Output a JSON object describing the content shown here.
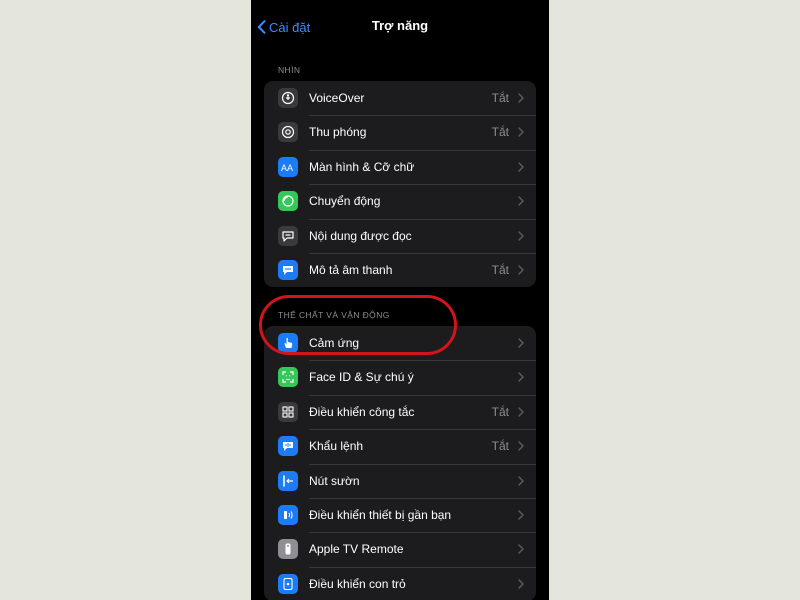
{
  "nav": {
    "back_label": "Cài đặt",
    "title": "Trợ năng"
  },
  "sections": [
    {
      "header": "NHÌN",
      "rows": [
        {
          "label": "VoiceOver",
          "value": "Tắt",
          "icon": "voiceover-icon",
          "color": "#3a3a3c"
        },
        {
          "label": "Thu phóng",
          "value": "Tắt",
          "icon": "zoom-icon",
          "color": "#3a3a3c"
        },
        {
          "label": "Màn hình & Cỡ chữ",
          "value": "",
          "icon": "text-size-icon",
          "color": "#1c7cf5"
        },
        {
          "label": "Chuyển động",
          "value": "",
          "icon": "motion-icon",
          "color": "#34c759"
        },
        {
          "label": "Nội dung được đọc",
          "value": "",
          "icon": "spoken-content-icon",
          "color": "#3a3a3c"
        },
        {
          "label": "Mô tả âm thanh",
          "value": "Tắt",
          "icon": "audio-description-icon",
          "color": "#1c7cf5"
        }
      ]
    },
    {
      "header": "THỂ CHẤT VÀ VẬN ĐỘNG",
      "rows": [
        {
          "label": "Cảm ứng",
          "value": "",
          "icon": "touch-hand-icon",
          "color": "#1c7cf5"
        },
        {
          "label": "Face ID & Sự chú ý",
          "value": "",
          "icon": "face-id-icon",
          "color": "#34c759"
        },
        {
          "label": "Điều khiển công tắc",
          "value": "Tắt",
          "icon": "switch-control-icon",
          "color": "#3a3a3c"
        },
        {
          "label": "Khẩu lệnh",
          "value": "Tắt",
          "icon": "voice-control-icon",
          "color": "#1c7cf5"
        },
        {
          "label": "Nút sườn",
          "value": "",
          "icon": "side-button-icon",
          "color": "#1c7cf5"
        },
        {
          "label": "Điều khiển thiết bị gần bạn",
          "value": "",
          "icon": "nearby-devices-icon",
          "color": "#1c7cf5"
        },
        {
          "label": "Apple TV Remote",
          "value": "",
          "icon": "tv-remote-icon",
          "color": "#8e8e93"
        },
        {
          "label": "Điều khiển con trỏ",
          "value": "",
          "icon": "pointer-control-icon",
          "color": "#1c7cf5"
        }
      ]
    }
  ],
  "highlight_color": "#d1141d"
}
